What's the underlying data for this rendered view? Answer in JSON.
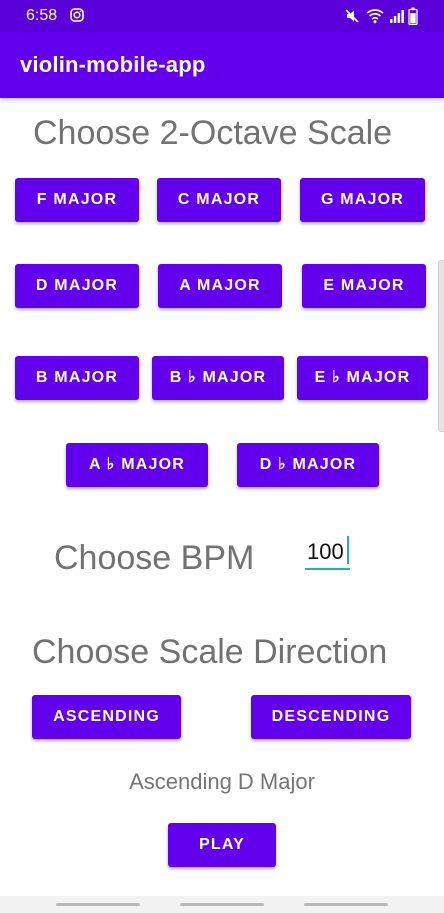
{
  "status_bar": {
    "time": "6:58",
    "icons": [
      "instagram-icon",
      "mute-icon",
      "wifi-icon",
      "signal-icon",
      "battery-icon"
    ]
  },
  "app_bar": {
    "title": "violin-mobile-app",
    "color": "#6200ee"
  },
  "scale_section": {
    "heading": "Choose 2-Octave Scale",
    "buttons": [
      {
        "label": "F MAJOR"
      },
      {
        "label": "C MAJOR"
      },
      {
        "label": "G MAJOR"
      },
      {
        "label": "D MAJOR"
      },
      {
        "label": "A MAJOR"
      },
      {
        "label": "E MAJOR"
      },
      {
        "label": "B MAJOR"
      },
      {
        "label": "B ♭ MAJOR"
      },
      {
        "label": "E ♭ MAJOR"
      },
      {
        "label": "A ♭ MAJOR"
      },
      {
        "label": "D ♭ MAJOR"
      }
    ]
  },
  "bpm_section": {
    "heading": "Choose BPM",
    "value": "100"
  },
  "direction_section": {
    "heading": "Choose Scale Direction",
    "ascending_label": "ASCENDING",
    "descending_label": "DESCENDING"
  },
  "selection_text": "Ascending D Major",
  "play_label": "PLAY",
  "colors": {
    "accent": "#6200ee",
    "status_bar": "#5a00d8",
    "input_underline": "#1fb6a6",
    "heading_text": "#727272"
  }
}
